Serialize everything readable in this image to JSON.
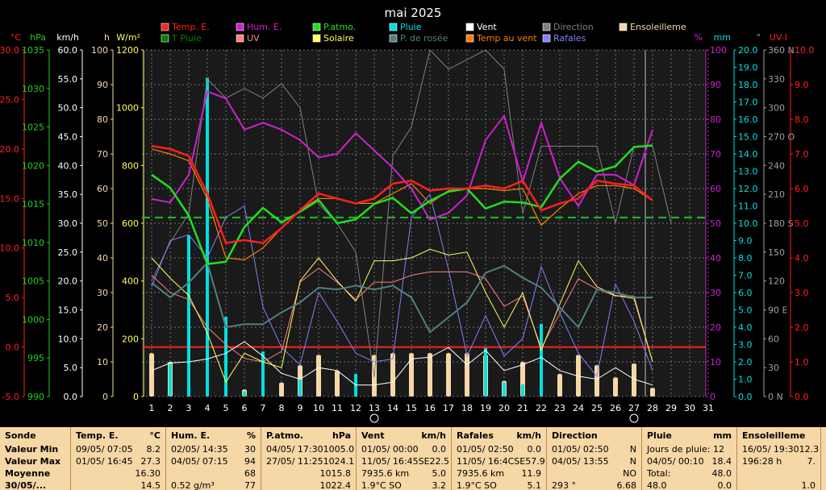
{
  "chart_data": {
    "type": "line",
    "title": "mai 2025",
    "x": [
      1,
      2,
      3,
      4,
      5,
      6,
      7,
      8,
      9,
      10,
      11,
      12,
      13,
      14,
      15,
      16,
      17,
      18,
      19,
      20,
      21,
      22,
      23,
      24,
      25,
      26,
      27,
      28,
      29,
      30,
      31
    ],
    "axes_left": [
      {
        "unit": "°C",
        "color": "#ff2020",
        "ticks": [
          "30.0",
          "25.0",
          "20.0",
          "15.0",
          "10.0",
          "5.0",
          "0.0",
          "-5.0"
        ]
      },
      {
        "unit": "hPa",
        "color": "#20d020",
        "ticks": [
          "1035",
          "1030",
          "1025",
          "1020",
          "1015",
          "1010",
          "1005",
          "1000",
          "995",
          "990"
        ]
      },
      {
        "unit": "km/h",
        "color": "#ffffff",
        "ticks": [
          "60.0",
          "55.0",
          "50.0",
          "45.0",
          "40.0",
          "35.0",
          "30.0",
          "25.0",
          "20.0",
          "15.0",
          "10.0",
          "5.0",
          "0.0"
        ]
      },
      {
        "unit": "h",
        "color": "#f6d7a6",
        "ticks": [
          "100",
          "90",
          "80",
          "70",
          "60",
          "50",
          "40",
          "30",
          "20",
          "10",
          "0"
        ]
      },
      {
        "unit": "W/m²",
        "color": "#ffff60",
        "ticks": [
          "1200",
          "1000",
          "800",
          "600",
          "400",
          "200",
          "0"
        ]
      }
    ],
    "axes_right": [
      {
        "unit": "%",
        "color": "#d020d0",
        "ticks": [
          "100",
          "90",
          "80",
          "70",
          "60",
          "50",
          "40",
          "30",
          "20",
          "10",
          "0"
        ]
      },
      {
        "unit": "mm",
        "color": "#00e0e0",
        "ticks": [
          "20.0",
          "19.0",
          "18.0",
          "17.0",
          "16.0",
          "15.0",
          "14.0",
          "13.0",
          "12.0",
          "11.0",
          "10.0",
          "9.0",
          "8.0",
          "7.0",
          "6.0",
          "5.0",
          "4.0",
          "3.0",
          "2.0",
          "1.0",
          "0.0"
        ]
      },
      {
        "unit": "°",
        "color": "#a0a0a0",
        "ticks": [
          "360 N",
          "330",
          "300",
          "270 O",
          "240",
          "210",
          "180 S",
          "150",
          "120",
          "90  E",
          "60",
          "30",
          "0  N"
        ]
      },
      {
        "unit": "UV-I",
        "color": "#ff2020",
        "ticks": [
          "10.0",
          "9.0",
          "8.0",
          "7.0",
          "6.0",
          "5.0",
          "4.0",
          "3.0",
          "2.0",
          "1.0",
          "0.0"
        ]
      }
    ],
    "legend": [
      {
        "name": "Temp. E.",
        "color": "#ff2020"
      },
      {
        "name": "T Pluie",
        "color": "#008000"
      },
      {
        "name": "Hum. E.",
        "color": "#d020d0"
      },
      {
        "name": "UV",
        "color": "#ff8080"
      },
      {
        "name": "P.atmo.",
        "color": "#20e020"
      },
      {
        "name": "Solaire",
        "color": "#ffff60"
      },
      {
        "name": "Pluie",
        "color": "#00e0e0"
      },
      {
        "name": "P. de rosée",
        "color": "#508080"
      },
      {
        "name": "Vent",
        "color": "#ffffff"
      },
      {
        "name": "Temp au vent",
        "color": "#ff8000"
      },
      {
        "name": "Direction",
        "color": "#808080"
      },
      {
        "name": "Rafales",
        "color": "#8080ff"
      },
      {
        "name": "Ensoleilleme",
        "color": "#f6d7a6"
      }
    ],
    "moon_days": [
      13,
      27
    ],
    "series": [
      {
        "name": "Temp. E.",
        "unit": "°C",
        "values": [
          20.3,
          20.0,
          19.3,
          15.5,
          10.5,
          10.8,
          10.5,
          12.0,
          13.8,
          15.5,
          15.0,
          14.5,
          15.0,
          16.5,
          16.8,
          15.8,
          16.0,
          16.0,
          16.3,
          16.0,
          16.8,
          13.8,
          14.5,
          15.0,
          16.8,
          16.5,
          16.3,
          14.8
        ]
      },
      {
        "name": "Temp au vent",
        "unit": "°C",
        "values": [
          20.0,
          19.5,
          18.8,
          15.0,
          9.0,
          8.8,
          10.0,
          12.0,
          13.8,
          15.0,
          15.0,
          14.5,
          14.5,
          15.5,
          16.5,
          14.5,
          15.8,
          16.0,
          16.0,
          15.8,
          16.0,
          12.3,
          14.0,
          15.5,
          16.3,
          16.3,
          16.0,
          14.8
        ]
      },
      {
        "name": "Hum. E.",
        "unit": "%",
        "values": [
          57,
          56,
          64,
          88,
          86,
          77,
          79,
          77,
          74,
          69,
          70,
          76,
          71,
          66,
          60,
          51,
          53,
          58,
          74,
          81,
          62,
          79,
          63,
          55,
          64,
          64,
          61,
          77
        ]
      },
      {
        "name": "P.atmo.",
        "unit": "hPa",
        "values": [
          1018.8,
          1017.1,
          1013.5,
          1007.2,
          1007.5,
          1012.0,
          1014.5,
          1012.6,
          1014.0,
          1015.5,
          1012.5,
          1013.0,
          1015.0,
          1015.8,
          1013.8,
          1015.4,
          1016.6,
          1017.0,
          1014.4,
          1015.3,
          1015.2,
          1014.6,
          1018.3,
          1020.5,
          1019.2,
          1019.9,
          1022.4,
          1022.6
        ]
      },
      {
        "name": "P. de rosée",
        "unit": "°C",
        "values": [
          6.5,
          5.0,
          6.5,
          8.5,
          2.0,
          2.3,
          2.3,
          3.5,
          4.5,
          6.0,
          5.8,
          6.2,
          5.8,
          6.2,
          5.0,
          1.5,
          3.0,
          4.5,
          7.5,
          8.2,
          7.0,
          6.0,
          4.0,
          2.0,
          5.8,
          5.5,
          5.0,
          5.0
        ]
      },
      {
        "name": "Solaire",
        "unit": "W/m²",
        "values": [
          480,
          410,
          350,
          220,
          50,
          150,
          120,
          100,
          400,
          480,
          400,
          330,
          470,
          470,
          480,
          510,
          490,
          500,
          360,
          240,
          360,
          160,
          320,
          470,
          380,
          350,
          340,
          120
        ]
      },
      {
        "name": "UV",
        "unit": "UV-I",
        "values": [
          3.5,
          3.0,
          2.8,
          2.0,
          1.5,
          1.1,
          1.0,
          1.3,
          3.3,
          3.7,
          3.3,
          2.8,
          3.3,
          3.3,
          3.5,
          3.6,
          3.6,
          3.6,
          3.4,
          2.6,
          2.9,
          1.4,
          2.4,
          3.4,
          3.1,
          2.9,
          2.9,
          1.0
        ]
      },
      {
        "name": "Vent",
        "unit": "km/h",
        "values": [
          4.5,
          5.8,
          6.0,
          6.5,
          7.5,
          9.5,
          7.0,
          4.0,
          3.0,
          5.0,
          4.5,
          2.0,
          2.0,
          2.5,
          6.5,
          6.8,
          8.5,
          5.5,
          8.0,
          4.5,
          5.5,
          6.8,
          4.5,
          3.5,
          3.0,
          5.0,
          3.0,
          2.0
        ]
      },
      {
        "name": "Rafales",
        "unit": "km/h",
        "values": [
          19.0,
          27.0,
          28.0,
          24.0,
          31.0,
          33.0,
          15.5,
          8.5,
          5.5,
          18.0,
          13.0,
          7.5,
          6.0,
          6.5,
          31.0,
          35.0,
          22.0,
          7.0,
          14.0,
          7.0,
          10.0,
          22.5,
          14.5,
          7.5,
          3.5,
          19.5,
          13.0,
          4.5
        ]
      },
      {
        "name": "Direction",
        "unit": "°",
        "values": [
          120,
          160,
          190,
          330,
          310,
          320,
          310,
          325,
          300,
          200,
          180,
          150,
          20,
          250,
          280,
          360,
          340,
          350,
          360,
          340,
          190,
          260,
          260,
          260,
          260,
          180,
          260,
          260,
          180
        ]
      },
      {
        "name": "Pluie",
        "unit": "mm",
        "values": [
          0,
          1.9,
          9.3,
          18.4,
          4.6,
          0.3,
          2.6,
          0,
          1.0,
          0,
          0,
          1.3,
          0,
          0,
          0,
          0,
          0,
          0,
          2.8,
          0.8,
          0.7,
          4.2,
          0,
          0,
          0,
          0,
          0,
          0
        ]
      },
      {
        "name": "Ensoleilleme",
        "unit": "h",
        "values": [
          12.5,
          10,
          0,
          0,
          0,
          2,
          0,
          4,
          9,
          12,
          7.5,
          0,
          12,
          12.5,
          12.5,
          12.5,
          12.5,
          12.5,
          12,
          4.5,
          10,
          0,
          6.5,
          12,
          9,
          5.5,
          9.5,
          2.5
        ]
      }
    ],
    "reference_lines": [
      {
        "axis": "°C",
        "value": 0.0,
        "color": "#ff2020"
      },
      {
        "axis": "hPa",
        "value": 1013.25,
        "color": "#20c020"
      }
    ]
  },
  "summary": {
    "labels": {
      "header": "Sonde",
      "min": "Valeur Min",
      "max": "Valeur Max",
      "avg": "Moyenne",
      "extra": "30/05/..."
    },
    "columns": [
      {
        "name": "Temp. E.",
        "unit": "°C",
        "width": 118,
        "rows": [
          [
            "09/05/  07:05",
            "8.2"
          ],
          [
            "01/05/  16:45",
            "27.3"
          ],
          [
            "",
            "16.30"
          ],
          [
            "",
            "14.5"
          ]
        ]
      },
      {
        "name": "Hum. E.",
        "unit": "%",
        "width": 118,
        "rows": [
          [
            "02/05/  14:35",
            "30"
          ],
          [
            "04/05/  07:15",
            "94"
          ],
          [
            "",
            "68"
          ],
          [
            "0.52 g/m³",
            "77"
          ]
        ]
      },
      {
        "name": "P.atmo.",
        "unit": "hPa",
        "width": 118,
        "rows": [
          [
            "04/05/  17:30",
            "1005.0"
          ],
          [
            "27/05/  11:25",
            "1024.1"
          ],
          [
            "",
            "1015.8"
          ],
          [
            "",
            "1022.4"
          ]
        ]
      },
      {
        "name": "Vent",
        "unit": "km/h",
        "width": 118,
        "rows": [
          [
            "01/05/  00:00",
            "0.0"
          ],
          [
            "11/05/  16:45SE",
            "22.5"
          ],
          [
            "7935.6 km",
            "5.0"
          ],
          [
            "1.9°C SO",
            "3.2"
          ]
        ]
      },
      {
        "name": "Rafales",
        "unit": "km/h",
        "width": 118,
        "rows": [
          [
            "01/05/  02:50",
            "0.0"
          ],
          [
            "11/05/  16:4CSE",
            "57.9"
          ],
          [
            "7935.6 km",
            "11.9"
          ],
          [
            "1.9°C SO",
            "5.1"
          ]
        ]
      },
      {
        "name": "Direction",
        "unit": "",
        "width": 118,
        "rows": [
          [
            "01/05/  02:50",
            "N"
          ],
          [
            "04/05/  13:55",
            "N"
          ],
          [
            "",
            "NO"
          ],
          [
            "293 °",
            "6.68"
          ]
        ]
      },
      {
        "name": "Pluie",
        "unit": "mm",
        "width": 118,
        "rows": [
          [
            "Jours de pluie: 12",
            ""
          ],
          [
            "04/05/  00:10",
            "18.4"
          ],
          [
            "Total:",
            "48.0"
          ],
          [
            "48.0",
            "0.0"
          ]
        ]
      },
      {
        "name": "Ensoleilleme",
        "unit": "",
        "width": 104,
        "rows": [
          [
            "16/05/  19:30",
            "12.3"
          ],
          [
            "196:28 h",
            "7."
          ],
          [
            "",
            ""
          ],
          [
            "",
            "1.0"
          ]
        ]
      }
    ]
  }
}
